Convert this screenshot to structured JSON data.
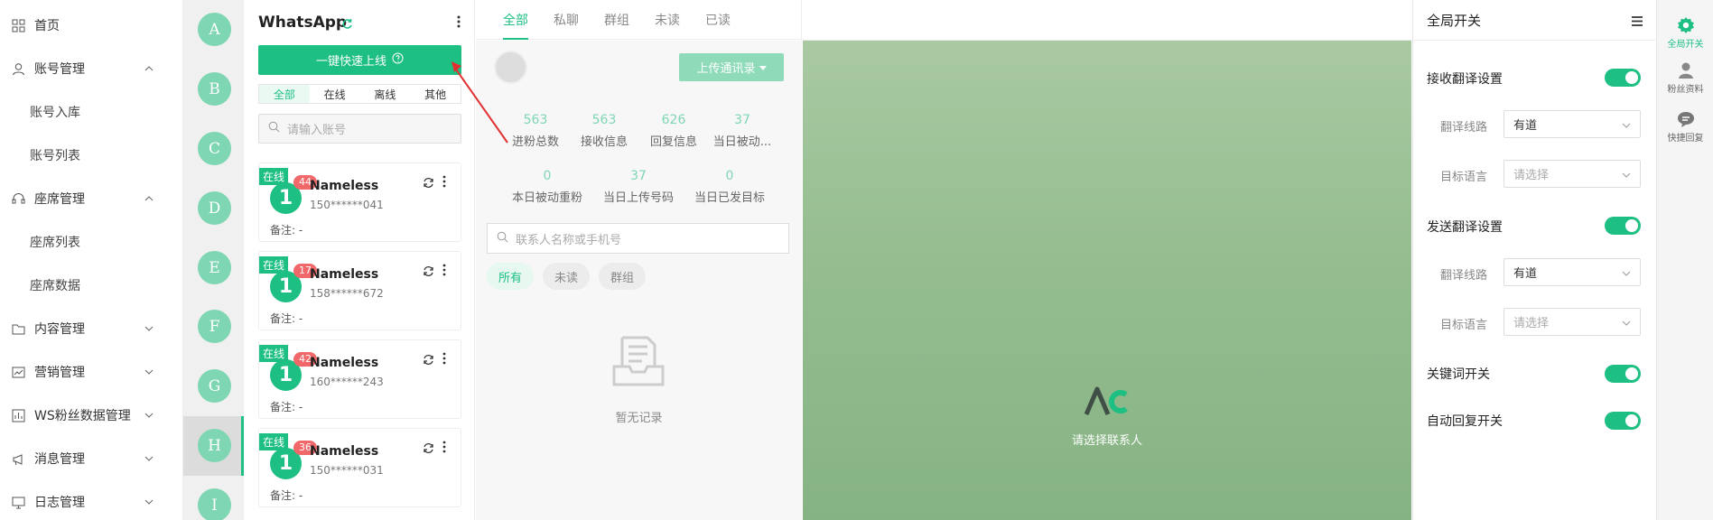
{
  "nav": {
    "items": [
      {
        "label": "首页",
        "icon": "grid-icon",
        "chevron": ""
      },
      {
        "label": "账号管理",
        "icon": "user-icon",
        "chevron": "up"
      },
      {
        "label": "座席管理",
        "icon": "headset-icon",
        "chevron": "up"
      },
      {
        "label": "内容管理",
        "icon": "folder-icon",
        "chevron": "down"
      },
      {
        "label": "营销管理",
        "icon": "chart-icon",
        "chevron": "down"
      },
      {
        "label": "WS粉丝数据管理",
        "icon": "bar-chart-icon",
        "chevron": "down"
      },
      {
        "label": "消息管理",
        "icon": "megaphone-icon",
        "chevron": "down"
      },
      {
        "label": "日志管理",
        "icon": "monitor-icon",
        "chevron": "down"
      }
    ],
    "subitems": {
      "account": [
        "账号入库",
        "账号列表"
      ],
      "seat": [
        "座席列表",
        "座席数据"
      ]
    }
  },
  "avatars": [
    "A",
    "B",
    "C",
    "D",
    "E",
    "F",
    "G",
    "H",
    "I"
  ],
  "accounts_panel": {
    "title": "WhatsApp",
    "quick_online_label": "一键快速上线",
    "filters": [
      "全部",
      "在线",
      "离线",
      "其他"
    ],
    "search_placeholder": "请输入账号",
    "cards": [
      {
        "tag": "在线",
        "badge": "44",
        "avatar": "1",
        "name": "Nameless",
        "phone": "150******041",
        "note": "备注: -"
      },
      {
        "tag": "在线",
        "badge": "17",
        "avatar": "1",
        "name": "Nameless",
        "phone": "158******672",
        "note": "备注: -"
      },
      {
        "tag": "在线",
        "badge": "42",
        "avatar": "1",
        "name": "Nameless",
        "phone": "160******243",
        "note": "备注: -"
      },
      {
        "tag": "在线",
        "badge": "36",
        "avatar": "1",
        "name": "Nameless",
        "phone": "150******031",
        "note": "备注: -"
      }
    ]
  },
  "chat_list": {
    "tabs": [
      "全部",
      "私聊",
      "群组",
      "未读",
      "已读"
    ],
    "upload_label": "上传通讯录",
    "stats": [
      {
        "value": "563",
        "label": "进粉总数"
      },
      {
        "value": "563",
        "label": "接收信息"
      },
      {
        "value": "626",
        "label": "回复信息"
      },
      {
        "value": "37",
        "label": "当日被动..."
      },
      {
        "value": "0",
        "label": "本日被动重粉"
      },
      {
        "value": "37",
        "label": "当日上传号码"
      },
      {
        "value": "0",
        "label": "当日已发目标"
      }
    ],
    "search_placeholder": "联系人名称或手机号",
    "chips": [
      "所有",
      "未读",
      "群组"
    ],
    "empty_text": "暂无记录"
  },
  "chat_area": {
    "hint": "请选择联系人"
  },
  "settings": {
    "title": "全局开关",
    "receive_label": "接收翻译设置",
    "send_label": "发送翻译设置",
    "route_label": "翻译线路",
    "target_label": "目标语言",
    "route_value": "有道",
    "target_placeholder": "请选择",
    "keyword_label": "关键词开关",
    "autoreply_label": "自动回复开关"
  },
  "right_bar": {
    "items": [
      {
        "label": "全局开关",
        "icon": "gear-icon"
      },
      {
        "label": "粉丝资料",
        "icon": "person-icon"
      },
      {
        "label": "快捷回复",
        "icon": "chat-bubble-icon"
      }
    ]
  },
  "colors": {
    "accent": "#1dbf83",
    "badge": "#f0686a",
    "avatar": "#7fd6b3"
  }
}
